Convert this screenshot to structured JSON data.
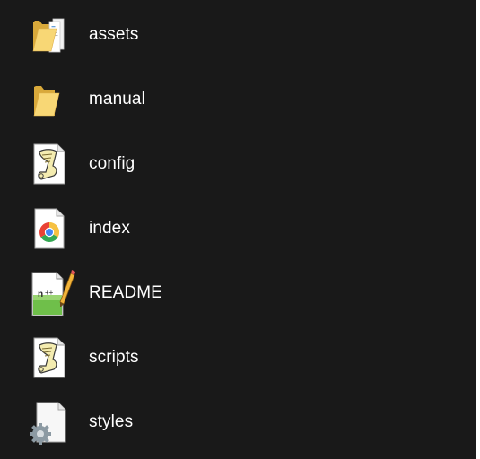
{
  "files": [
    {
      "name": "assets",
      "icon": "folder-with-files-icon"
    },
    {
      "name": "manual",
      "icon": "folder-icon"
    },
    {
      "name": "config",
      "icon": "script-file-icon"
    },
    {
      "name": "index",
      "icon": "chrome-html-file-icon"
    },
    {
      "name": "README",
      "icon": "notepadpp-file-icon"
    },
    {
      "name": "scripts",
      "icon": "script-file-icon"
    },
    {
      "name": "styles",
      "icon": "settings-file-icon"
    }
  ],
  "colors": {
    "background": "#191919",
    "text": "#ffffff",
    "folder": "#f4c65a"
  }
}
